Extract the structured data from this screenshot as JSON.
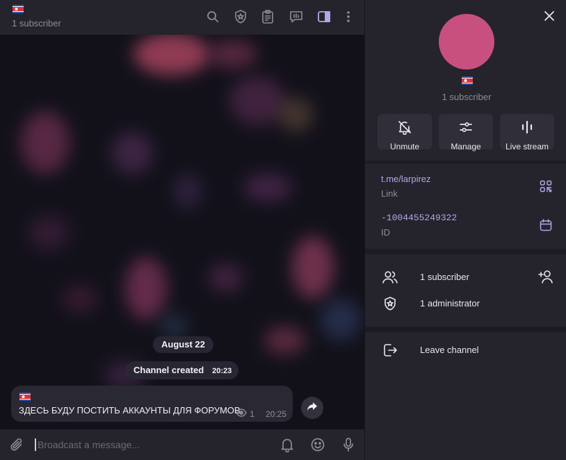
{
  "chat": {
    "header": {
      "subscribers": "1 subscriber",
      "icons": [
        "search-icon",
        "shield-star-icon",
        "clipboard-icon",
        "poll-icon",
        "sidebar-toggle-icon",
        "more-vertical-icon"
      ]
    },
    "date_separator": "August 22",
    "service_message": {
      "text": "Channel created",
      "time": "20:23"
    },
    "message": {
      "text": "ЗДЕСЬ БУДУ ПОСТИТЬ АККАУНТЫ ДЛЯ ФОРУМОВ",
      "views": "1",
      "time": "20:25"
    },
    "composer": {
      "placeholder": "Broadcast a message...",
      "icons": [
        "attach-icon",
        "bell-icon",
        "emoji-icon",
        "microphone-icon"
      ]
    }
  },
  "panel": {
    "subscribers": "1 subscriber",
    "avatar_color": "#c8507f",
    "actions": [
      {
        "label": "Unmute",
        "icon": "bell-off-icon"
      },
      {
        "label": "Manage",
        "icon": "sliders-icon"
      },
      {
        "label": "Live stream",
        "icon": "live-stream-icon"
      }
    ],
    "link": {
      "value": "t.me/larpirez",
      "label": "Link",
      "icon": "qr-code-icon"
    },
    "id": {
      "value": "-1004455249322",
      "label": "ID",
      "icon": "calendar-icon"
    },
    "rows": [
      {
        "text": "1 subscriber",
        "icon": "users-icon",
        "action_icon": "add-user-icon"
      },
      {
        "text": "1 administrator",
        "icon": "shield-star-icon"
      }
    ],
    "leave": {
      "text": "Leave channel",
      "icon": "leave-icon"
    }
  },
  "colors": {
    "accent": "#b7a6e9",
    "panel_bg": "#25232c",
    "chat_bg": "#14131c",
    "bubble": "#2a2933"
  }
}
